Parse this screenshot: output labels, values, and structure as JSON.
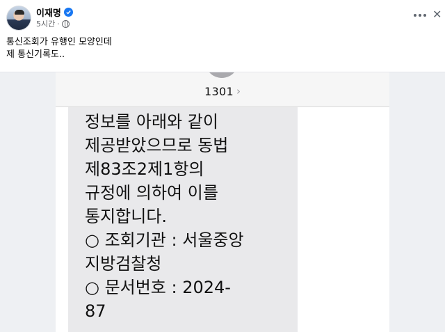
{
  "post": {
    "author": "이재명",
    "time": "5시간",
    "text_lines": [
      "통신조회가 유행인 모양인데",
      "제 통신기록도.."
    ]
  },
  "icons": {
    "verified": "verified-badge-icon",
    "audience": "globe-icon",
    "more": "more-options-icon",
    "close": "close-icon"
  },
  "colors": {
    "verified": "#1877f2",
    "meta_text": "#65676b",
    "bubble": "#e9e9eb"
  },
  "message": {
    "sender": "1301",
    "lines": [
      "정보를 아래와 같이",
      "제공받았으므로 동법",
      "제83조2제1항의",
      "규정에 의하여 이를",
      "통지합니다.",
      " ○ 조회기관 : 서울중앙",
      "지방검찰청",
      " ○ 문서번호 : 2024-",
      "87"
    ]
  }
}
